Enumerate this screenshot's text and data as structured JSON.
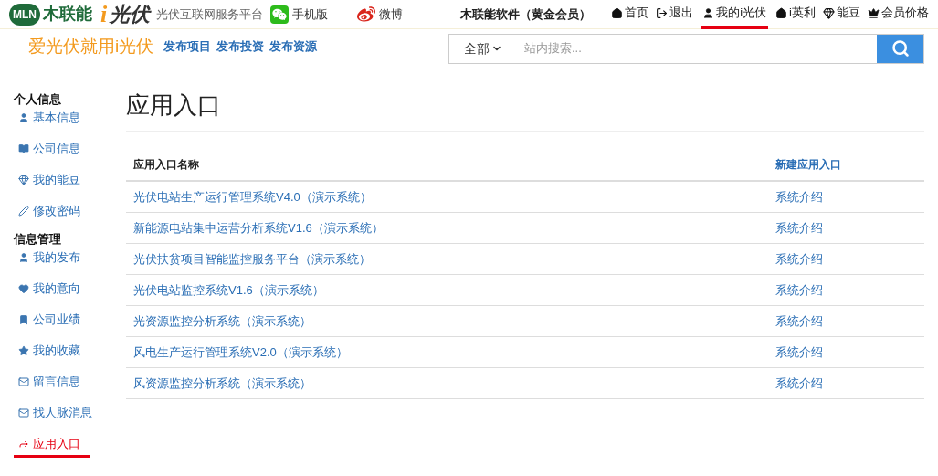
{
  "header": {
    "logo": {
      "mark": "MLN",
      "name": "木联能",
      "brand_i": "i",
      "brand": "光伏",
      "tagline": "光伏互联网服务平台"
    },
    "social": [
      {
        "kind": "chat",
        "label": "手机版"
      },
      {
        "kind": "weibo",
        "label": "微博"
      }
    ],
    "account": "木联能软件（黄金会员）",
    "nav": [
      {
        "kind": "home",
        "label": "首页",
        "selected": false
      },
      {
        "kind": "logout",
        "label": "退出",
        "selected": false
      },
      {
        "kind": "user",
        "label": "我的i光伏",
        "selected": true
      },
      {
        "kind": "home",
        "label": "i英利",
        "selected": false
      },
      {
        "kind": "gem",
        "label": "能豆",
        "selected": false
      },
      {
        "kind": "crown",
        "label": "会员价格",
        "selected": false
      }
    ]
  },
  "subbar": {
    "slogan": "爱光伏就用i光伏",
    "links": [
      "发布项目",
      "发布投资",
      "发布资源"
    ],
    "search": {
      "scope": "全部",
      "placeholder": "站内搜索..."
    }
  },
  "sidebar": [
    {
      "heading": "个人信息",
      "items": [
        {
          "kind": "user",
          "label": "基本信息",
          "selected": false
        },
        {
          "kind": "book",
          "label": "公司信息",
          "selected": false
        },
        {
          "kind": "gem",
          "label": "我的能豆",
          "selected": false
        },
        {
          "kind": "pencil",
          "label": "修改密码",
          "selected": false
        }
      ]
    },
    {
      "heading": "信息管理",
      "items": [
        {
          "kind": "user",
          "label": "我的发布",
          "selected": false
        },
        {
          "kind": "heart",
          "label": "我的意向",
          "selected": false
        },
        {
          "kind": "bookmark",
          "label": "公司业绩",
          "selected": false
        },
        {
          "kind": "star",
          "label": "我的收藏",
          "selected": false
        },
        {
          "kind": "mail",
          "label": "留言信息",
          "selected": false
        },
        {
          "kind": "mail",
          "label": "找人脉消息",
          "selected": false
        },
        {
          "kind": "share",
          "label": "应用入口",
          "selected": true
        }
      ]
    }
  ],
  "main": {
    "title": "应用入口",
    "table": {
      "columns": [
        "应用入口名称",
        "新建应用入口"
      ],
      "rows": [
        {
          "name": "光伏电站生产运行管理系统V4.0（演示系统）",
          "action": "系统介绍"
        },
        {
          "name": "新能源电站集中运营分析系统V1.6（演示系统）",
          "action": "系统介绍"
        },
        {
          "name": "光伏扶贫项目智能监控服务平台（演示系统）",
          "action": "系统介绍"
        },
        {
          "name": "光伏电站监控系统V1.6（演示系统）",
          "action": "系统介绍"
        },
        {
          "name": "光资源监控分析系统（演示系统）",
          "action": "系统介绍"
        },
        {
          "name": "风电生产运行管理系统V2.0（演示系统）",
          "action": "系统介绍"
        },
        {
          "name": "风资源监控分析系统（演示系统）",
          "action": "系统介绍"
        }
      ]
    }
  }
}
